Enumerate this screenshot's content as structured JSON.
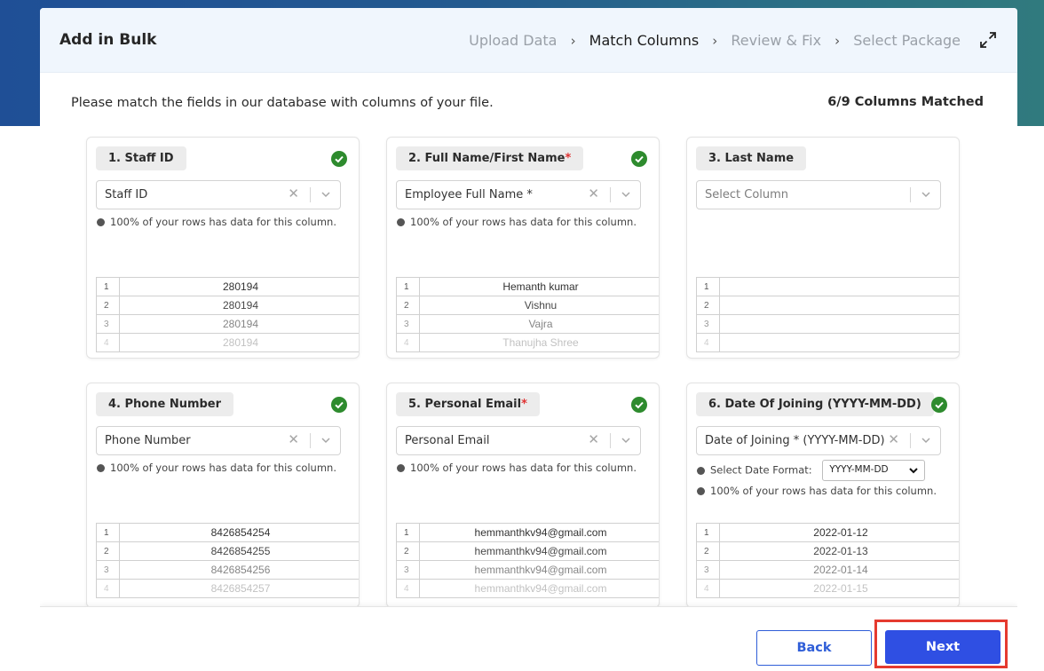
{
  "modal": {
    "title": "Add in Bulk",
    "steps": [
      "Upload Data",
      "Match Columns",
      "Review & Fix",
      "Select Package"
    ],
    "active_step": "Match Columns"
  },
  "intro_text": "Please match the fields in our database with columns of your file.",
  "matched_text": "6/9 Columns Matched",
  "info_text": "100% of your rows has data for this column.",
  "clear_glyph": "✕",
  "cards": [
    {
      "label": "1. Staff ID",
      "required": false,
      "matched": true,
      "selected": "Staff ID",
      "rows": [
        {
          "n": "1",
          "v": "280194"
        },
        {
          "n": "2",
          "v": "280194"
        },
        {
          "n": "3",
          "v": "280194"
        },
        {
          "n": "4",
          "v": "280194"
        }
      ]
    },
    {
      "label": "2. Full Name/First Name",
      "required": true,
      "matched": true,
      "selected": "Employee Full Name *",
      "rows": [
        {
          "n": "1",
          "v": "Hemanth kumar"
        },
        {
          "n": "2",
          "v": "Vishnu"
        },
        {
          "n": "3",
          "v": "Vajra"
        },
        {
          "n": "4",
          "v": "Thanujha Shree"
        }
      ]
    },
    {
      "label": "3. Last Name",
      "required": false,
      "matched": false,
      "placeholder": "Select Column",
      "rows": [
        {
          "n": "1",
          "v": ""
        },
        {
          "n": "2",
          "v": ""
        },
        {
          "n": "3",
          "v": ""
        },
        {
          "n": "4",
          "v": ""
        }
      ]
    },
    {
      "label": "4. Phone Number",
      "required": false,
      "matched": true,
      "selected": "Phone Number",
      "rows": [
        {
          "n": "1",
          "v": "8426854254"
        },
        {
          "n": "2",
          "v": "8426854255"
        },
        {
          "n": "3",
          "v": "8426854256"
        },
        {
          "n": "4",
          "v": "8426854257"
        }
      ]
    },
    {
      "label": "5. Personal Email",
      "required": true,
      "matched": true,
      "selected": "Personal Email",
      "rows": [
        {
          "n": "1",
          "v": "hemmanthkv94@gmail.com"
        },
        {
          "n": "2",
          "v": "hemmanthkv94@gmail.com"
        },
        {
          "n": "3",
          "v": "hemmanthkv94@gmail.com"
        },
        {
          "n": "4",
          "v": "hemmanthkv94@gmail.com"
        }
      ]
    },
    {
      "label": "6. Date Of Joining (YYYY-MM-DD)",
      "required": false,
      "matched": true,
      "selected": "Date of Joining * (YYYY-MM-DD)",
      "date_format_label": "Select Date Format:",
      "date_format_value": "YYYY-MM-DD",
      "rows": [
        {
          "n": "1",
          "v": "2022-01-12"
        },
        {
          "n": "2",
          "v": "2022-01-13"
        },
        {
          "n": "3",
          "v": "2022-01-14"
        },
        {
          "n": "4",
          "v": "2022-01-15"
        }
      ]
    }
  ],
  "footer": {
    "back_label": "Back",
    "next_label": "Next"
  },
  "colors": {
    "accent": "#2f4fe3",
    "success": "#2e8b2e",
    "required": "#e03232",
    "highlight": "#e53a2f"
  }
}
